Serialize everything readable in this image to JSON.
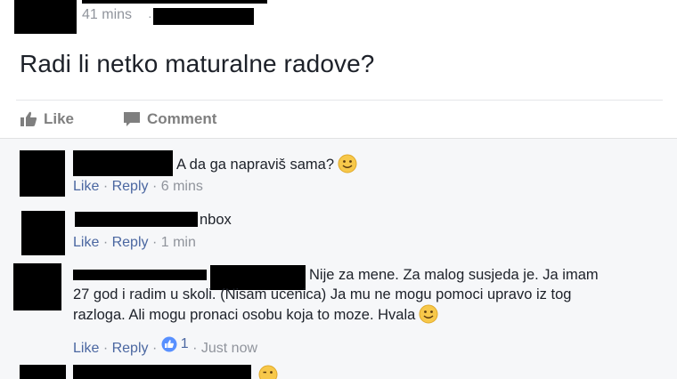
{
  "post": {
    "time": "41 mins",
    "text": "Radi li netko maturalne radove?"
  },
  "actions": {
    "like": "Like",
    "comment": "Comment"
  },
  "comments": [
    {
      "text": "A da ga napraviš sama?",
      "emoji": "smiley-icon",
      "meta": {
        "like": "Like",
        "reply": "Reply",
        "time": "6 mins"
      }
    },
    {
      "text": "nbox",
      "meta": {
        "like": "Like",
        "reply": "Reply",
        "time": "1 min"
      }
    },
    {
      "text_lines": [
        "Nije za mene. Za malog susjeda je. Ja imam",
        "27 god i radim u skoli. (Nisam ucenica) Ja mu ne mogu pomoci upravo iz tog",
        "razloga. Ali mogu pronaci osobu koja to moze. Hvala"
      ],
      "emoji": "smiley-icon",
      "meta": {
        "like": "Like",
        "reply": "Reply",
        "reactions": "1",
        "time": "Just now"
      }
    }
  ],
  "colors": {
    "link": "#4b67a1",
    "meta_gray": "#90949c",
    "reaction_blue": "#5890ff",
    "smiley_yellow": "#f7c84a"
  }
}
